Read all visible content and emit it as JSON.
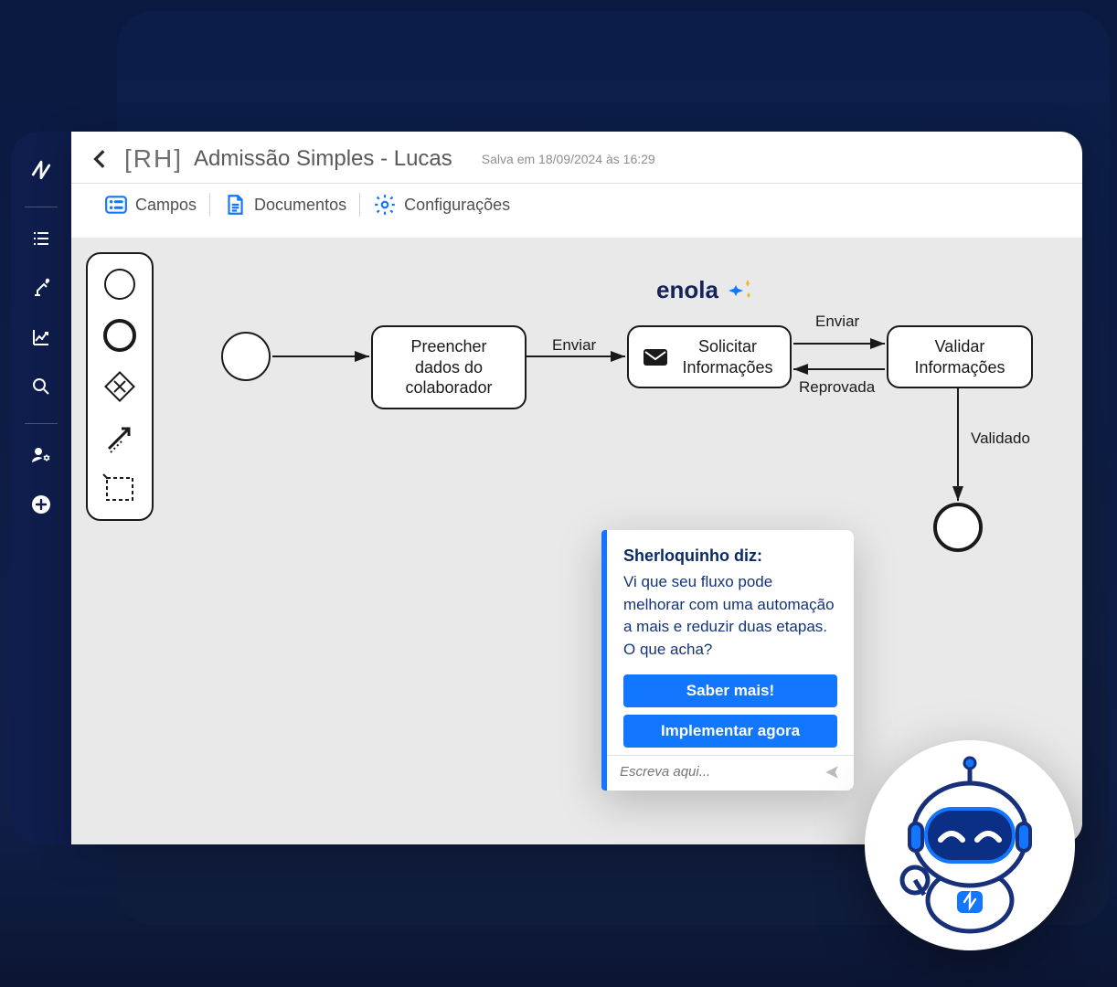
{
  "header": {
    "prefix": "[RH]",
    "title": "Admissão Simples - Lucas",
    "save_info": "Salva em 18/09/2024 às 16:29"
  },
  "toolbar": {
    "tabs": [
      {
        "label": "Campos",
        "icon": "fields-icon"
      },
      {
        "label": "Documentos",
        "icon": "document-icon"
      },
      {
        "label": "Configurações",
        "icon": "settings-icon"
      }
    ]
  },
  "sidebar": {
    "items": [
      {
        "icon": "logo"
      },
      {
        "icon": "list-check-icon"
      },
      {
        "icon": "robot-arm-icon"
      },
      {
        "icon": "chart-up-icon"
      },
      {
        "icon": "search-icon"
      },
      {
        "icon": "user-gear-icon"
      },
      {
        "icon": "plus-circle-icon"
      }
    ]
  },
  "palette": {
    "tools": [
      "circle-thin-icon",
      "circle-thick-icon",
      "diamond-x-icon",
      "arrow-dashed-icon",
      "rectangle-dashed-icon"
    ]
  },
  "diagram": {
    "enola_label": "enola",
    "nodes": [
      {
        "id": "n1",
        "text": "Preencher dados do colaborador"
      },
      {
        "id": "n2",
        "text": "Solicitar Informações"
      },
      {
        "id": "n3",
        "text": "Validar Informações"
      }
    ],
    "edges": [
      {
        "label": "Enviar"
      },
      {
        "label": "Enviar"
      },
      {
        "label": "Reprovada"
      },
      {
        "label": "Validado"
      }
    ]
  },
  "chat": {
    "assistant_name": "Sherloquinho diz:",
    "message": "Vi que seu fluxo pode melhorar com uma automação a mais e reduzir duas etapas. O que acha?",
    "primary_button": "Saber mais!",
    "secondary_button": "Implementar agora",
    "input_placeholder": "Escreva aqui..."
  }
}
